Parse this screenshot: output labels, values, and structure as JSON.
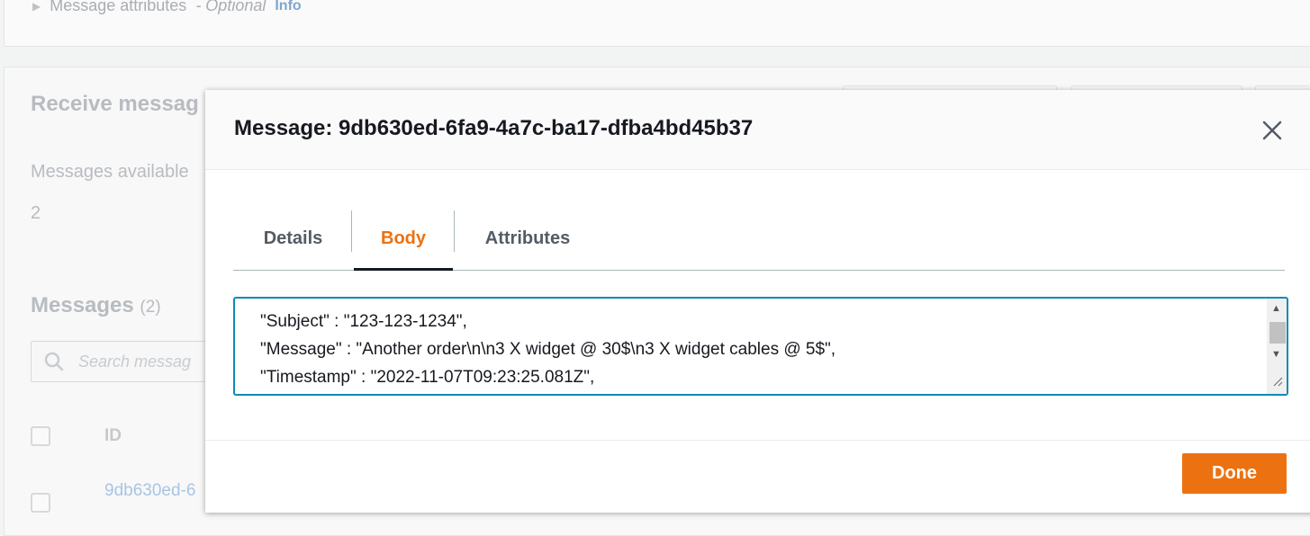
{
  "background": {
    "message_attributes": {
      "label": "Message attributes",
      "optional": "- Optional",
      "info": "Info"
    },
    "receive_messages": {
      "heading": "Receive messag",
      "available_label": "Messages available",
      "available_value": "2"
    },
    "messages_panel": {
      "heading": "Messages",
      "count": "(2)",
      "search_placeholder": "Search messag",
      "column_id": "ID",
      "row_id": "9db630ed-6"
    }
  },
  "modal": {
    "title": "Message: 9db630ed-6fa9-4a7c-ba17-dfba4bd45b37",
    "tabs": [
      {
        "label": "Details",
        "active": false
      },
      {
        "label": "Body",
        "active": true
      },
      {
        "label": "Attributes",
        "active": false
      }
    ],
    "body_lines": [
      "\"Subject\" : \"123-123-1234\",",
      "\"Message\" : \"Another order\\n\\n3 X widget @ 30$\\n3 X widget cables @ 5$\",",
      "\"Timestamp\" : \"2022-11-07T09:23:25.081Z\","
    ],
    "done_label": "Done"
  },
  "icons": {
    "close": "close-icon",
    "search": "search-icon",
    "scroll_up": "chevron-up-icon",
    "scroll_down": "chevron-down-icon",
    "resize": "resize-grip-icon"
  },
  "colors": {
    "accent": "#ec7211",
    "focus_border": "#0f8bb5",
    "text": "#16191f",
    "tab_inactive": "#545b64"
  }
}
